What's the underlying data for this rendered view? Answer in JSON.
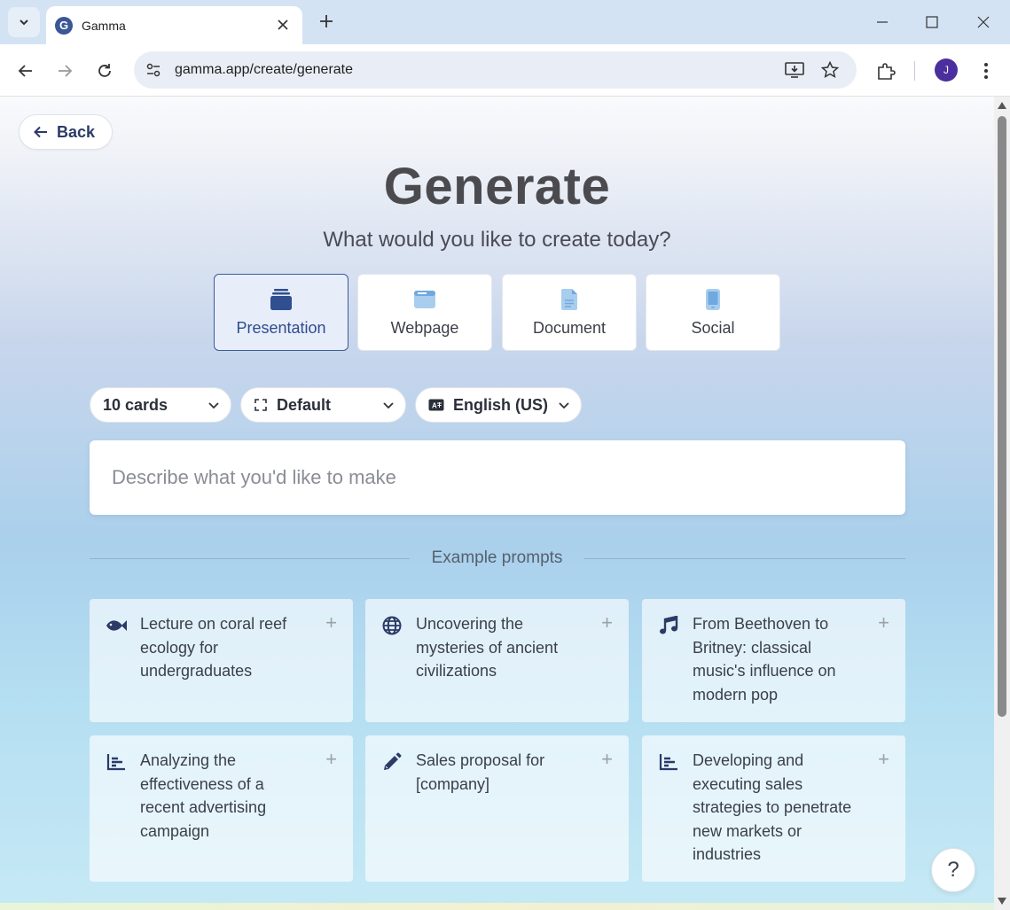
{
  "browser": {
    "tab_title": "Gamma",
    "tab_favicon_letter": "G",
    "url": "gamma.app/create/generate",
    "avatar_letter": "J"
  },
  "page": {
    "back_label": "Back",
    "title": "Generate",
    "subtitle": "What would you like to create today?",
    "types": [
      {
        "label": "Presentation",
        "icon": "presentation-icon",
        "active": true
      },
      {
        "label": "Webpage",
        "icon": "webpage-icon",
        "active": false
      },
      {
        "label": "Document",
        "icon": "document-icon",
        "active": false
      },
      {
        "label": "Social",
        "icon": "social-icon",
        "active": false
      }
    ],
    "options": {
      "cards": "10 cards",
      "theme": "Default",
      "language": "English (US)"
    },
    "prompt_placeholder": "Describe what you'd like to make",
    "examples_heading": "Example prompts",
    "examples": [
      {
        "text": "Lecture on coral reef ecology for undergraduates",
        "icon": "fish-icon"
      },
      {
        "text": "Uncovering the mysteries of ancient civilizations",
        "icon": "globe-icon"
      },
      {
        "text": "From Beethoven to Britney: classical music's influence on modern pop",
        "icon": "music-icon"
      },
      {
        "text": "Analyzing the effectiveness of a recent advertising campaign",
        "icon": "bar-chart-icon"
      },
      {
        "text": "Sales proposal for [company]",
        "icon": "pencil-icon"
      },
      {
        "text": "Developing and executing sales strategies to penetrate new markets or industries",
        "icon": "bar-chart-icon"
      }
    ],
    "help_label": "?"
  },
  "colors": {
    "accent": "#3d5b96",
    "title": "#4a4a4f",
    "icon_dark": "#2b3a67",
    "icon_light": "#a9cdee"
  }
}
